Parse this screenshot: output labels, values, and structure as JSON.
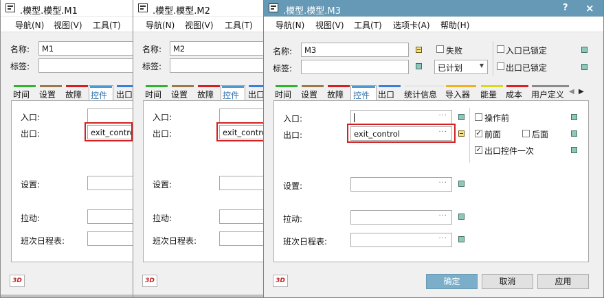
{
  "windows": [
    {
      "title": ".模型.模型.M1",
      "menu": [
        "导航(N)",
        "视图(V)",
        "工具(T)"
      ],
      "name_label": "名称:",
      "name_value": "M1",
      "tag_label": "标签:",
      "tabs": [
        "时间",
        "设置",
        "故障",
        "控件",
        "出口"
      ],
      "active_tab": "控件",
      "fields": {
        "entry": "入口:",
        "exit": "出口:",
        "exit_value": "exit_control",
        "setup": "设置:",
        "pull": "拉动:",
        "shift": "班次日程表:"
      }
    },
    {
      "title": ".模型.模型.M2",
      "menu": [
        "导航(N)",
        "视图(V)",
        "工具(T)"
      ],
      "name_label": "名称:",
      "name_value": "M2",
      "tag_label": "标签:",
      "tabs": [
        "时间",
        "设置",
        "故障",
        "控件",
        "出口"
      ],
      "active_tab": "控件",
      "fields": {
        "entry": "入口:",
        "exit": "出口:",
        "exit_value": "exit_control",
        "setup": "设置:",
        "pull": "拉动:",
        "shift": "班次日程表:"
      }
    },
    {
      "title": ".模型.模型.M3",
      "title_buttons": {
        "help": "?",
        "close": "×"
      },
      "menu": [
        "导航(N)",
        "视图(V)",
        "工具(T)",
        "选项卡(A)",
        "帮助(H)"
      ],
      "name_label": "名称:",
      "name_value": "M3",
      "tag_label": "标签:",
      "failed_label": "失败",
      "status_value": "已计划",
      "entry_locked_label": "入口已锁定",
      "exit_locked_label": "出口已锁定",
      "tabs": [
        "时间",
        "设置",
        "故障",
        "控件",
        "出口",
        "统计信息",
        "导入器",
        "能量",
        "成本",
        "用户定义"
      ],
      "active_tab": "控件",
      "fields": {
        "entry": "入口:",
        "exit": "出口:",
        "exit_value": "exit_control",
        "setup": "设置:",
        "pull": "拉动:",
        "shift": "班次日程表:"
      },
      "options": {
        "before_action": "操作前",
        "front": "前面",
        "back": "后面",
        "exit_control_once": "出口控件一次"
      },
      "buttons": {
        "ok": "确定",
        "cancel": "取消",
        "apply": "应用"
      }
    }
  ],
  "icon_3d_text": "3D",
  "ellipsis": "···",
  "tab_colors": [
    "#2db52d",
    "#9b7a4a",
    "#d62020",
    "#4c9ad0",
    "#3c7de0",
    "#e8e8e8",
    "#f0b020",
    "#d8d820",
    "#e02020",
    "#8a8a8a"
  ]
}
